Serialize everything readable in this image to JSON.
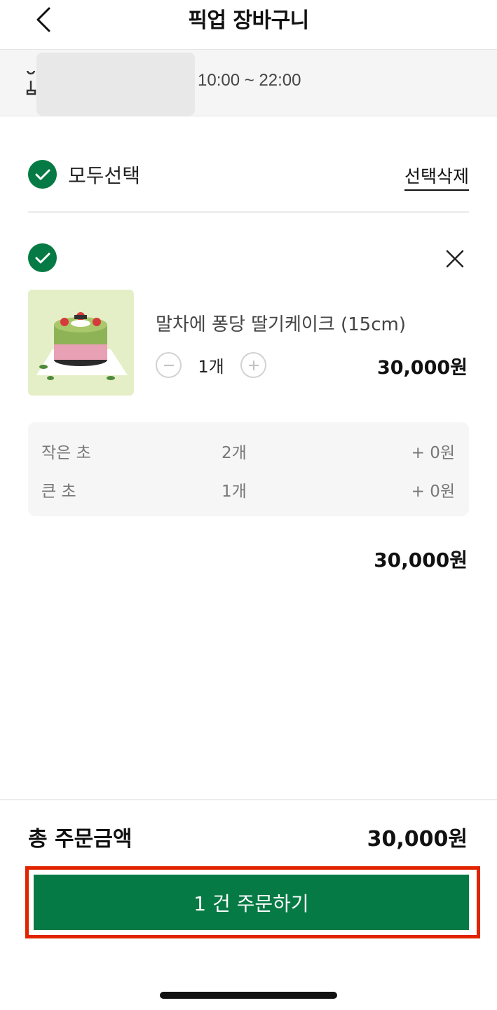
{
  "header": {
    "title": "픽업 장바구니"
  },
  "store": {
    "hours": "10:00 ~ 22:00"
  },
  "cart": {
    "select_all_label": "모두선택",
    "delete_selected_label": "선택삭제",
    "item": {
      "name": "말차에 퐁당 딸기케이크 (15cm)",
      "quantity": "1개",
      "price": "30,000원",
      "options": [
        {
          "name": "작은 초",
          "qty": "2개",
          "price": "+ 0원"
        },
        {
          "name": "큰 초",
          "qty": "1개",
          "price": "+ 0원"
        }
      ],
      "total": "30,000원"
    }
  },
  "footer": {
    "total_label": "총 주문금액",
    "total_amount": "30,000원",
    "order_button": "1 건 주문하기"
  },
  "colors": {
    "accent": "#067a45",
    "highlight": "#e02400"
  }
}
